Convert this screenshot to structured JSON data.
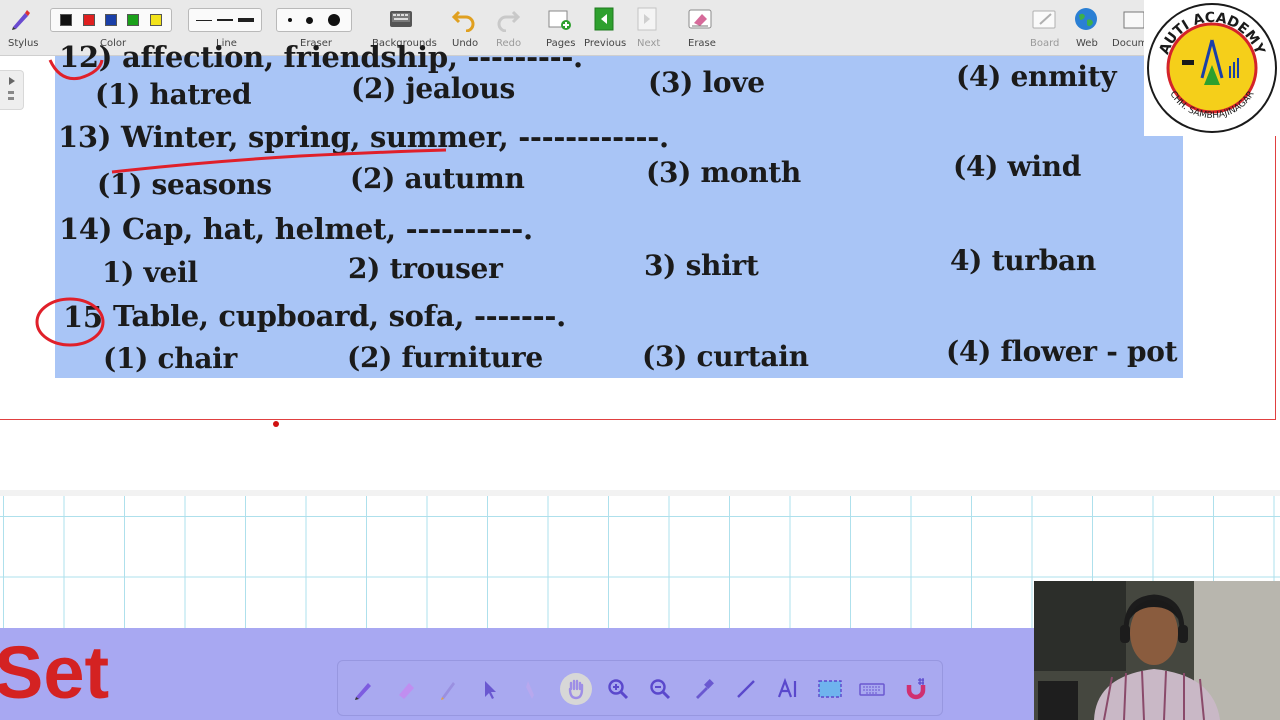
{
  "toolbar": {
    "stylus": "Stylus",
    "color": "Color",
    "line": "Line",
    "eraser": "Eraser",
    "backgrounds": "Backgrounds",
    "undo": "Undo",
    "redo": "Redo",
    "pages": "Pages",
    "previous": "Previous",
    "next": "Next",
    "erase": "Erase",
    "board": "Board",
    "web": "Web",
    "documents": "Docum",
    "colors": [
      "#111111",
      "#e02020",
      "#1a3fa8",
      "#1aa01a",
      "#f2e21a"
    ]
  },
  "worksheet": {
    "q12_partial": "12) affection, friendship, ---------.",
    "q12_options": [
      "(1) hatred",
      "(2) jealous",
      "(3) love",
      "(4) enmity"
    ],
    "q13": "13) Winter, spring, summer, ------------.",
    "q13_options": [
      "(1) seasons",
      "(2) autumn",
      "(3) month",
      "(4) wind"
    ],
    "q14": "14) Cap, hat, helmet, ----------.",
    "q14_options": [
      "1) veil",
      "2) trouser",
      "3) shirt",
      "4) turban"
    ],
    "q15_number": "15",
    "q15_text": "Table, cupboard, sofa, -------.",
    "q15_options": [
      "(1) chair",
      "(2) furniture",
      "(3) curtain",
      "(4) flower - pot"
    ]
  },
  "logo": {
    "top_text": "AUTI ACADEMY",
    "bottom_text": "CHH. SAMBHAJINAGAR"
  },
  "board": {
    "set_text": "Set"
  },
  "bottom_tools": [
    "pen-icon",
    "highlighter-icon",
    "marker-icon",
    "select-arrow-icon",
    "pointer-hand-icon",
    "pan-hand-icon",
    "zoom-in-icon",
    "zoom-out-icon",
    "eyedropper-icon",
    "line-icon",
    "text-ai-icon",
    "screen-capture-icon",
    "keyboard-icon",
    "magnet-icon"
  ],
  "accent_colors": {
    "scan_bg": "#a9c5f6",
    "annotation_red": "#e0202a",
    "band_purple": "#a8a8f2"
  }
}
